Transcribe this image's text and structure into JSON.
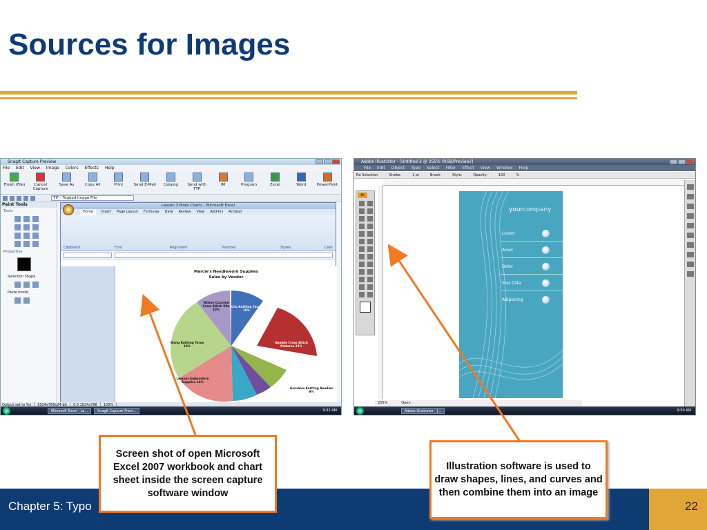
{
  "slide": {
    "title": "Sources for Images",
    "footer_text": "Chapter 5: Typo",
    "page_number": "22",
    "accent_color": "#dba83b",
    "brand_color": "#0f3b73"
  },
  "snagit": {
    "window_title": "SnagIt Capture Preview",
    "menu": [
      "File",
      "Edit",
      "View",
      "Image",
      "Colors",
      "Effects",
      "Help"
    ],
    "toolbar": [
      "Finish (File)",
      "Cancel Capture",
      "Save As",
      "Copy All",
      "Print",
      "Send E-Mail",
      "Catalog",
      "Send with FTP",
      "IM",
      "Program",
      "Excel",
      "Word",
      "PowerPoint"
    ],
    "file_type": "TIF - Tagged Image File",
    "paint_tools_title": "Paint Tools",
    "tools_label": "Tools",
    "properties_label": "Properties",
    "selection_shape_label": "Selection Shape",
    "paste_mode_label": "Paste mode:",
    "status": [
      "Output set to %s",
      "1024x768x24-bit",
      "0,0  1024x768",
      "100%"
    ]
  },
  "excel": {
    "window_title": "Lesson 3 More Charts - Microsoft Excel",
    "tabs": [
      "Home",
      "Insert",
      "Page Layout",
      "Formulas",
      "Data",
      "Review",
      "View",
      "Add-Ins",
      "Acrobat"
    ],
    "groups": [
      "Clipboard",
      "Font",
      "Alignment",
      "Number",
      "Styles",
      "Cells"
    ],
    "chart_title_line1": "Marcie's Needlework Supplies",
    "chart_title_line2": "Sales by Vendor",
    "pie_labels": [
      "Wilson Counted Cross Stitch Kits 10%",
      "Cho Knitting Yarns 10%",
      "Gamble Cross Stitch Patterns 21%",
      "Wang Knitting Yarns 18%",
      "Lemons Embroidery Supplies 14%",
      "Gonzales Knitting Needles 9%"
    ]
  },
  "taskbar1": {
    "buttons": [
      "Microsoft Excel - Le...",
      "SnagIt Capture Previ..."
    ],
    "clock": "9:32 AM"
  },
  "illustrator": {
    "window_title": "Adobe Illustrator - [Untitled-2 @ 255% (RGB/Preview)]",
    "menu": [
      "File",
      "Edit",
      "Object",
      "Type",
      "Select",
      "Filter",
      "Effect",
      "View",
      "Window",
      "Help"
    ],
    "control_bar": [
      "No Selection",
      "Stroke:",
      "1 pt",
      "Brush:",
      "Style:",
      "Opacity:",
      "100",
      "%"
    ],
    "artboard_brand_your": "your",
    "artboard_brand_company": "company",
    "artboard_items": [
      "Lorem",
      "Amet",
      "Dolor",
      "Stet Clita",
      "Adipiscing"
    ],
    "zoom": "255%",
    "status_open": "Open"
  },
  "taskbar2": {
    "buttons": [
      "Adobe Illustrator - [..."
    ],
    "clock": "9:50 AM"
  },
  "callouts": {
    "left": "Screen shot of open Microsoft Excel 2007 workbook and chart sheet inside the screen capture software window",
    "right": "Illustration software is used to draw shapes, lines, and curves and then combine them into an image"
  }
}
